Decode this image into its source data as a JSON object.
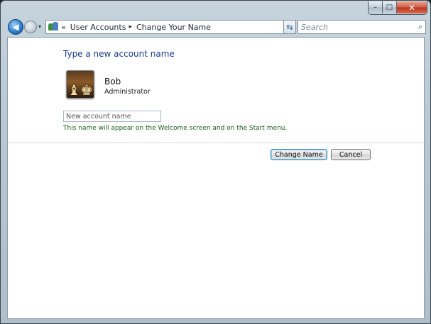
{
  "window": {
    "caption": {
      "minimize": "–",
      "maximize": "□",
      "close": "✕"
    }
  },
  "nav": {
    "back_icon": "back-arrow-icon",
    "forward_icon": "forward-arrow-icon",
    "history_dropdown": "▾",
    "breadcrumb_overflow": "«",
    "breadcrumbs": [
      "User Accounts",
      "Change Your Name"
    ],
    "breadcrumb_separator": "▸",
    "address_dropdown": "▾",
    "refresh_icon": "refresh-icon",
    "search_placeholder": "Search"
  },
  "content": {
    "heading": "Type a new account name",
    "user": {
      "name": "Bob",
      "role": "Administrator"
    },
    "input": {
      "placeholder": "New account name",
      "value": ""
    },
    "hint": "This name will appear on the Welcome screen and on the Start menu.",
    "buttons": {
      "primary": "Change Name",
      "cancel": "Cancel"
    }
  },
  "colors": {
    "heading": "#1e3c8c",
    "hint": "#1b5e1b",
    "close_button": "#c8412a"
  }
}
